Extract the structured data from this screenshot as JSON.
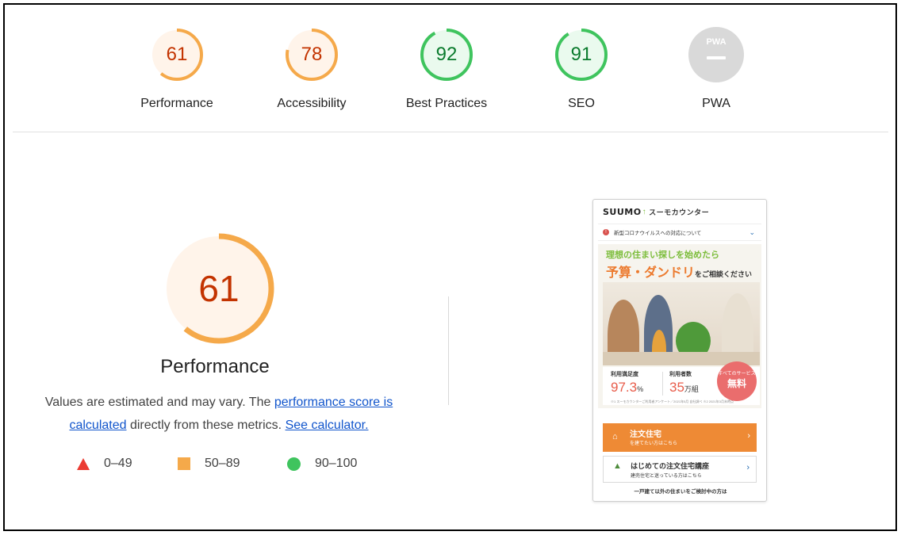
{
  "categories": [
    {
      "label": "Performance",
      "score": "61",
      "status": "average"
    },
    {
      "label": "Accessibility",
      "score": "78",
      "status": "average"
    },
    {
      "label": "Best Practices",
      "score": "92",
      "status": "pass"
    },
    {
      "label": "SEO",
      "score": "91",
      "status": "pass"
    },
    {
      "label": "PWA",
      "score": "",
      "status": "na",
      "icon": "pwa-icon",
      "icon_text": "PWA"
    }
  ],
  "colors": {
    "average_ring": "#f5a94a",
    "average_fill": "#fff4ea",
    "average_text": "#c33300",
    "pass_ring": "#3fc45e",
    "pass_fill": "#eafaee",
    "pass_text": "#0a7b2d",
    "fail": "#eb3b32",
    "na_fill": "#d9d9d9"
  },
  "performance": {
    "score": "61",
    "score_fraction": 0.61,
    "title": "Performance",
    "desc_prefix": "Values are estimated and may vary. The ",
    "desc_link1": "performance score is calculated",
    "desc_middle": " directly from these metrics. ",
    "desc_link2": "See calculator."
  },
  "legend": [
    {
      "range": "0–49",
      "shape": "triangle"
    },
    {
      "range": "50–89",
      "shape": "square"
    },
    {
      "range": "90–100",
      "shape": "circle"
    }
  ],
  "screenshot": {
    "logo": "SUUMO",
    "logo_sub": "スーモカウンター",
    "notice": "新型コロナウイルスへの対応について",
    "headline1": "理想の住まい探しを始めたら",
    "headline2": "予算・ダンドリ",
    "headline2_suffix": "をご相談ください",
    "stat1_label": "利用満足度",
    "stat1_value": "97.3",
    "stat1_unit": "%",
    "stat2_label": "利用者数",
    "stat2_value": "35",
    "stat2_unit": "万組",
    "fine_print": "※1 スーモカウンターご利用者アンケート／2021年5月 自社調べ ※2 2021年3月末時点",
    "badge_top": "すべてのサービス",
    "badge_main": "無料",
    "btn1_title": "注文住宅",
    "btn1_sub": "を建てたい方はこちら",
    "btn2_title": "はじめての注文住宅講座",
    "btn2_sub": "建売住宅と迷っている方はこちら",
    "footer": "一戸建て以外の住まいをご検討中の方は"
  }
}
